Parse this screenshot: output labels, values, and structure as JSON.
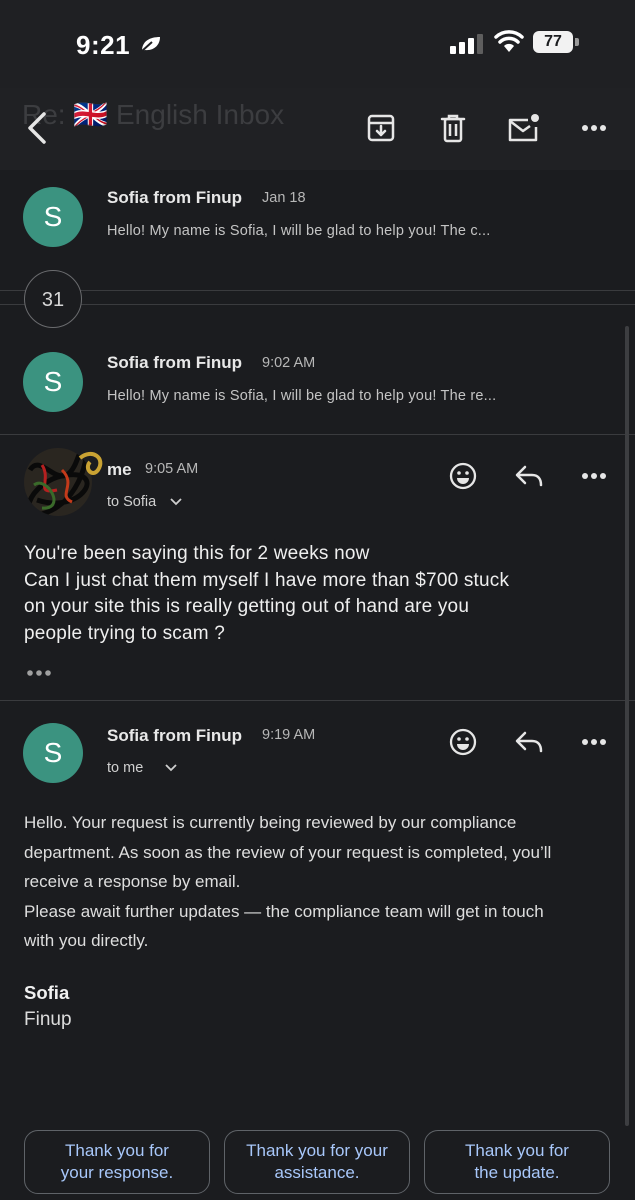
{
  "status_bar": {
    "time": "9:21",
    "battery": "77"
  },
  "toolbar": {
    "ghost_subject": "Re: 🇬🇧 English  Inbox"
  },
  "thread": [
    {
      "avatar": "S",
      "sender": "Sofia from Finup",
      "date": "Jan 18",
      "snippet": "Hello! My name is Sofia, I will be glad to help you! The c..."
    },
    {
      "avatar": "S",
      "sender": "Sofia from Finup",
      "date": "9:02 AM",
      "snippet": "Hello! My name is Sofia, I will be glad to help you! The re..."
    }
  ],
  "collapsed": {
    "count": "31"
  },
  "my_message": {
    "sender": "me",
    "time": "9:05 AM",
    "to": "to Sofia",
    "body": [
      "You're been saying this for 2 weeks now",
      "Can I just chat them myself I have more than $700 stuck",
      "on your site this is really getting out of hand are you",
      "people trying to scam ?"
    ]
  },
  "reply": {
    "avatar": "S",
    "sender": "Sofia from Finup",
    "time": "9:19 AM",
    "to": "to me",
    "body": [
      "Hello. Your request is currently being reviewed by our compliance",
      "department. As soon as the review of your request is completed, you’ll",
      "receive a response by email.",
      "Please await further updates — the compliance team will get in touch",
      "with you directly."
    ],
    "signature_name": "Sofia",
    "signature_org": "Finup"
  },
  "smart_replies": [
    {
      "line1": "Thank you for",
      "line2": "your response."
    },
    {
      "line1": "Thank you for your",
      "line2": "assistance."
    },
    {
      "line1": "Thank you for",
      "line2": "the update."
    }
  ],
  "colors": {
    "background": "#1b1c1f",
    "avatar": "#3b9380",
    "chip_text": "#a8c7fa"
  },
  "icons": [
    "back-arrow-icon",
    "archive-icon",
    "trash-icon",
    "mark-unread-icon",
    "more-vert-icon",
    "emoji-icon",
    "reply-icon",
    "chevron-down-icon"
  ]
}
